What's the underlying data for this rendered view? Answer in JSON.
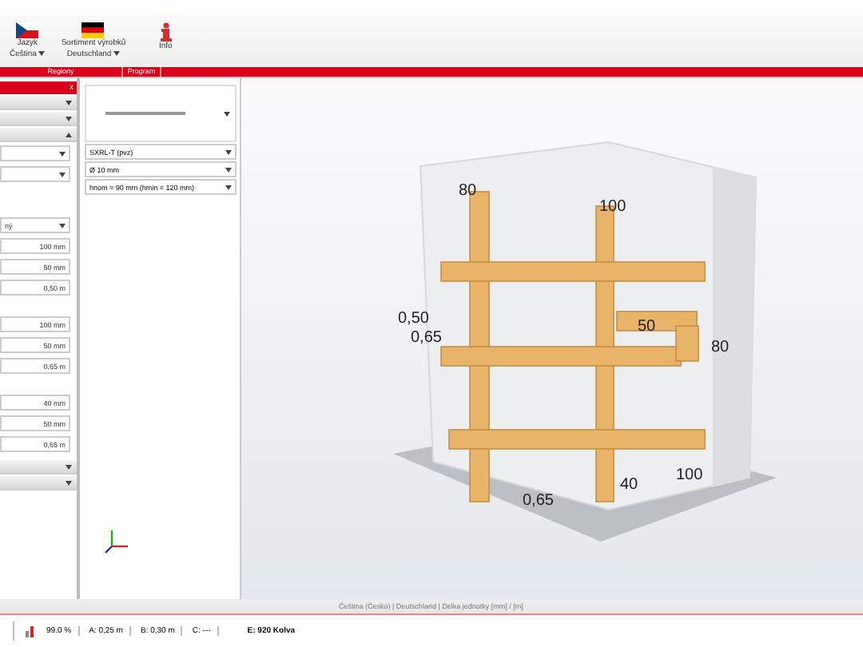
{
  "ribbon": {
    "buttons": [
      {
        "kind": "flag-cz",
        "label": "Jazyk",
        "sublabel": "Čeština"
      },
      {
        "kind": "flag-de",
        "label": "Sortiment výrobků",
        "sublabel": "Deutschland"
      },
      {
        "kind": "info",
        "label": "Info"
      }
    ],
    "groups": [
      "Regiony",
      "Program"
    ]
  },
  "left_panel": {
    "close": "x",
    "sections": [
      {
        "expanded": false
      },
      {
        "expanded": false
      },
      {
        "expanded": true
      }
    ],
    "fields": [
      {
        "kind": "select"
      },
      {
        "kind": "select"
      },
      {
        "kind": "gap"
      },
      {
        "kind": "select",
        "value": "ný"
      },
      {
        "kind": "input",
        "value": "100 mm"
      },
      {
        "kind": "input",
        "value": "50 mm"
      },
      {
        "kind": "input",
        "value": "0,50 m"
      },
      {
        "kind": "gap"
      },
      {
        "kind": "input",
        "value": "100 mm"
      },
      {
        "kind": "input",
        "value": "50 mm"
      },
      {
        "kind": "input",
        "value": "0,65 m"
      },
      {
        "kind": "gap"
      },
      {
        "kind": "input",
        "value": "40 mm"
      },
      {
        "kind": "input",
        "value": "50 mm"
      },
      {
        "kind": "input",
        "value": "0,65 m"
      }
    ],
    "footer_sections": [
      {
        "expanded": false
      },
      {
        "expanded": false
      }
    ]
  },
  "product_panel": {
    "selects": [
      "SXRL-T (pvz)",
      "Ø 10 mm",
      "hnom = 90 mm (hmin = 120 mm)"
    ]
  },
  "viewport": {
    "labels": [
      "80",
      "100",
      "0,50",
      "0,65",
      "50",
      "80",
      "0,65",
      "40",
      "100"
    ]
  },
  "status_bar": "Čeština (Česko) | Deutschland | Délka jednotky [mm] / [m]",
  "bottom_bar": {
    "percent": "99.0 %",
    "a": "A: 0,25 m",
    "b": "B: 0,30 m",
    "c": "C: ---",
    "e": "E: 920 Kolva"
  }
}
